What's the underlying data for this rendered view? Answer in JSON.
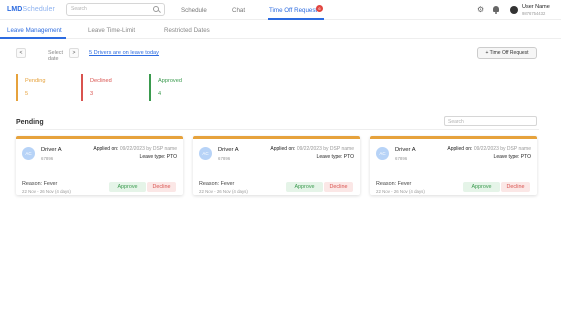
{
  "app": {
    "brand_main": "LMD",
    "brand_sub": "Scheduler"
  },
  "topnav": {
    "search_placeholder": "Search",
    "items": [
      {
        "label": "Schedule"
      },
      {
        "label": "Chat"
      },
      {
        "label": "Time Off Request"
      }
    ],
    "badge_count": "6",
    "user_name": "User Name",
    "user_phone": "9876754432"
  },
  "tabs": [
    {
      "label": "Leave Management"
    },
    {
      "label": "Leave Time-Limit"
    },
    {
      "label": "Restricted Dates"
    }
  ],
  "toolbar": {
    "prev": "<",
    "next": ">",
    "select_date": "Select date",
    "drivers_link": "5 Drivers are on leave today",
    "time_off_button": "Time Off Request"
  },
  "stats": [
    {
      "label": "Pending",
      "value": "5",
      "color": "#e6a23c"
    },
    {
      "label": "Declined",
      "value": "3",
      "color": "#d9534f"
    },
    {
      "label": "Approved",
      "value": "4",
      "color": "#3a9a4e"
    }
  ],
  "pending": {
    "title": "Pending",
    "search_placeholder": "Search",
    "cards": [
      {
        "initials": "AC",
        "name": "Driver A",
        "id": "67896",
        "applied_label": "Applied on:",
        "applied_value": "09/22/2023 by DSP name",
        "leave_label": "Leave type:",
        "leave_value": "PTO",
        "reason": "Reason: Fever",
        "range": "22 Nov - 26 Nov (4 days)",
        "approve": "Approve",
        "decline": "Decline"
      },
      {
        "initials": "AC",
        "name": "Driver A",
        "id": "67896",
        "applied_label": "Applied on:",
        "applied_value": "09/22/2023 by DSP name",
        "leave_label": "Leave type:",
        "leave_value": "PTO",
        "reason": "Reason: Fever",
        "range": "22 Nov - 26 Nov (4 days)",
        "approve": "Approve",
        "decline": "Decline"
      },
      {
        "initials": "AC",
        "name": "Driver A",
        "id": "67896",
        "applied_label": "Applied on:",
        "applied_value": "09/22/2023 by DSP name",
        "leave_label": "Leave type:",
        "leave_value": "PTO",
        "reason": "Reason: Fever",
        "range": "22 Nov - 26 Nov (4 days)",
        "approve": "Approve",
        "decline": "Decline"
      }
    ]
  },
  "colors": {
    "accent": "#2c6be0",
    "pending": "#e6a23c",
    "declined": "#d9534f",
    "approved": "#3a9a4e"
  }
}
